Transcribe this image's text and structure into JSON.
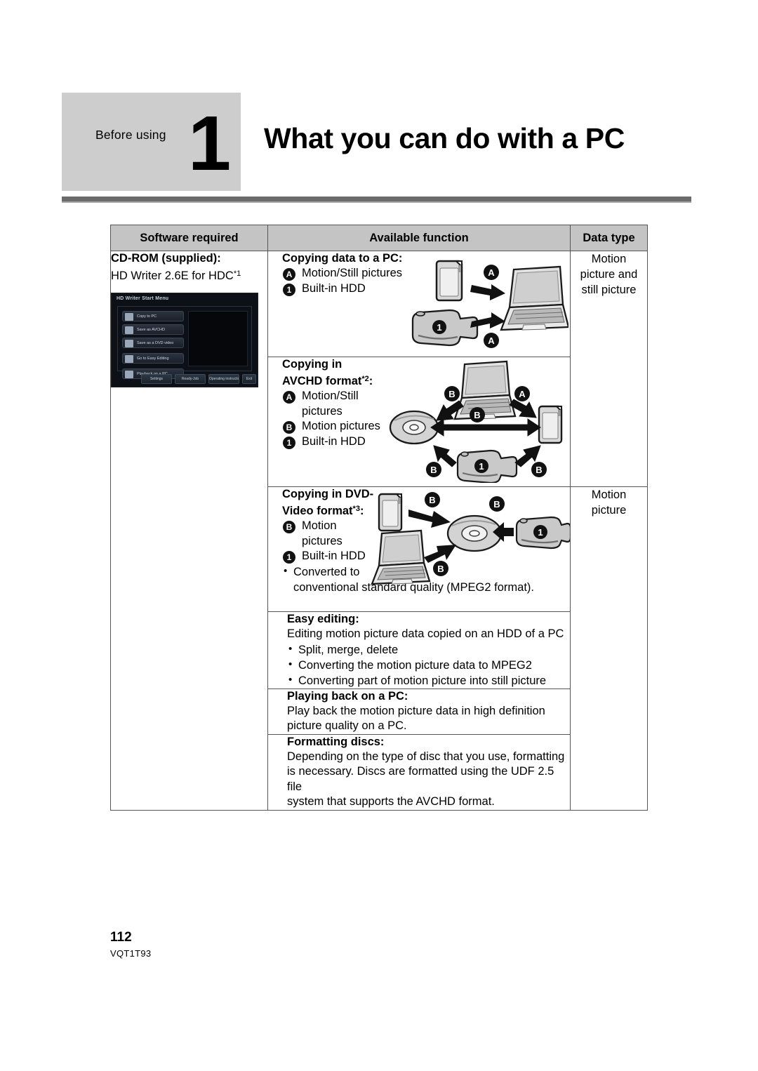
{
  "header": {
    "kicker": "Before using",
    "chapter_number": "1",
    "title": "What you can do with a PC"
  },
  "table": {
    "columns": [
      "Software required",
      "Available function",
      "Data type"
    ],
    "software": {
      "title": "CD-ROM (supplied):",
      "subtitle": "HD Writer 2.6E for HDC",
      "footnote_marker": "*1",
      "screenshot": {
        "window_title": "HD Writer  Start Menu",
        "buttons": [
          "Copy to PC",
          "Save as AVCHD",
          "Save as a DVD video",
          "Go to Easy Editing",
          "Playback on a PC"
        ],
        "footer_buttons": [
          "Settings",
          "Ready-Job",
          "Operating instructions",
          "Exit"
        ]
      }
    },
    "rows": [
      {
        "title": "Copying data to a PC:",
        "items": [
          {
            "badge": "A",
            "text": "Motion/Still pictures"
          },
          {
            "badge": "1",
            "text": "Built-in HDD"
          }
        ],
        "diagram": "sd-camcorder-to-pc"
      },
      {
        "title_lines": [
          "Copying in",
          "AVCHD format"
        ],
        "footnote_marker": "*2",
        "title_suffix": ":",
        "items": [
          {
            "badge": "A",
            "text": "Motion/Still"
          },
          {
            "badge": "",
            "text": "pictures"
          },
          {
            "badge": "B",
            "text": "Motion pictures"
          },
          {
            "badge": "1",
            "text": "Built-in HDD"
          }
        ],
        "diagram": "pc-disc-sd-camcorder"
      },
      {
        "title_lines": [
          "Copying in DVD-",
          "Video format"
        ],
        "footnote_marker": "*3",
        "title_suffix": ":",
        "items": [
          {
            "badge": "B",
            "text": "Motion"
          },
          {
            "badge": "",
            "text": "pictures"
          },
          {
            "badge": "1",
            "text": "Built-in HDD"
          }
        ],
        "bullets": [
          "Converted to"
        ],
        "bullet_continuation": "conventional standard quality (MPEG2 format).",
        "diagram": "sd-pc-camcorder-to-disc"
      },
      {
        "title": "Easy editing:",
        "body": "Editing motion picture data copied on an HDD of a PC",
        "bullets": [
          "Split, merge, delete",
          "Converting the motion picture data to MPEG2",
          "Converting part of motion picture into still picture"
        ]
      },
      {
        "title": "Playing back on a PC:",
        "body_lines": [
          "Play back the motion picture data in high definition",
          "picture quality on a PC."
        ]
      },
      {
        "title": "Formatting discs:",
        "body_lines": [
          "Depending on the type of disc that you use, formatting",
          "is necessary. Discs are formatted using the UDF 2.5 file",
          "system that supports the AVCHD format."
        ]
      }
    ],
    "data_types": [
      {
        "lines": [
          "Motion",
          "picture and",
          "still picture"
        ]
      },
      {
        "lines": [
          "Motion",
          "picture"
        ]
      }
    ]
  },
  "footer": {
    "page_number": "112",
    "document_code": "VQT1T93"
  },
  "colors": {
    "badge_bg": "#cdcdcd",
    "rule": "#6b6b6b",
    "table_header_bg": "#c4c4c4",
    "border": "#555555"
  }
}
